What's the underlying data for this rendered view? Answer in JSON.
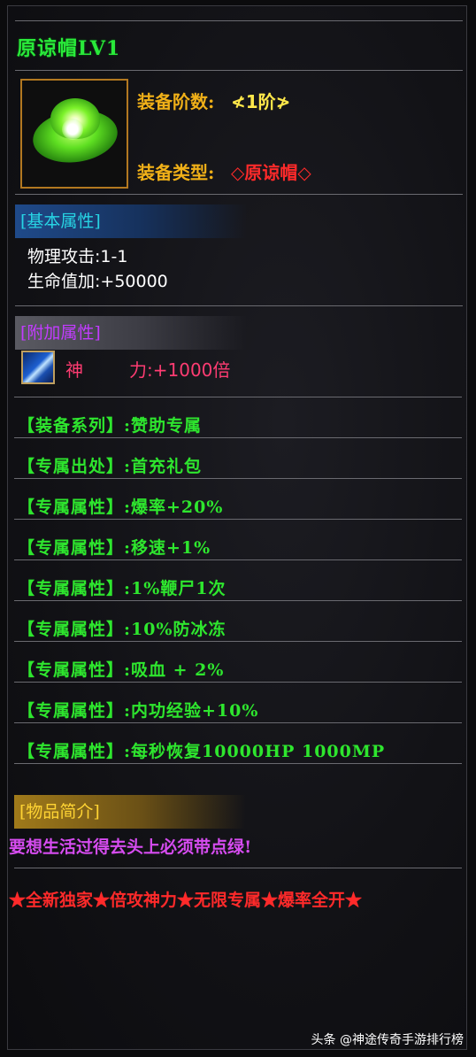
{
  "item": {
    "title": "原谅帽LV1",
    "icon": "green-hat-icon",
    "rank_label": "装备阶数:",
    "rank_value": "≮1阶≯",
    "type_label": "装备类型:",
    "type_value": "◇原谅帽◇"
  },
  "basic": {
    "header": "[基本属性]",
    "lines": [
      "物理攻击:1-1",
      "生命值加:+50000"
    ]
  },
  "extra": {
    "header": "[附加属性]",
    "skill_icon": "sword-icon",
    "skill_name": "神",
    "skill_value": "力:+1000倍"
  },
  "exclusive_rows": [
    "【装备系列】:赞助专属",
    "【专属出处】:首充礼包",
    "【专属属性】:爆率+20%",
    "【专属属性】:移速+1%",
    "【专属属性】:1%鞭尸1次",
    "【专属属性】:10%防冰冻",
    "【专属属性】:吸血 + 2%",
    "【专属属性】:内功经验+10%",
    "【专属属性】:每秒恢复10000HP 1000MP"
  ],
  "description": {
    "header": "[物品简介]",
    "text": "要想生活过得去头上必须带点绿!"
  },
  "slogan": "★全新独家★倍攻神力★无限专属★爆率全开★",
  "watermark": "头条 @神途传奇手游排行榜",
  "colors": {
    "title": "#29e93a",
    "label": "#f0b018",
    "rank_value": "#ffe84a",
    "type_value": "#ff2a2a",
    "skill": "#ff3c72",
    "exclusive": "#2ee62e",
    "desc": "#d64cf0",
    "slogan": "#ff2a2a"
  }
}
